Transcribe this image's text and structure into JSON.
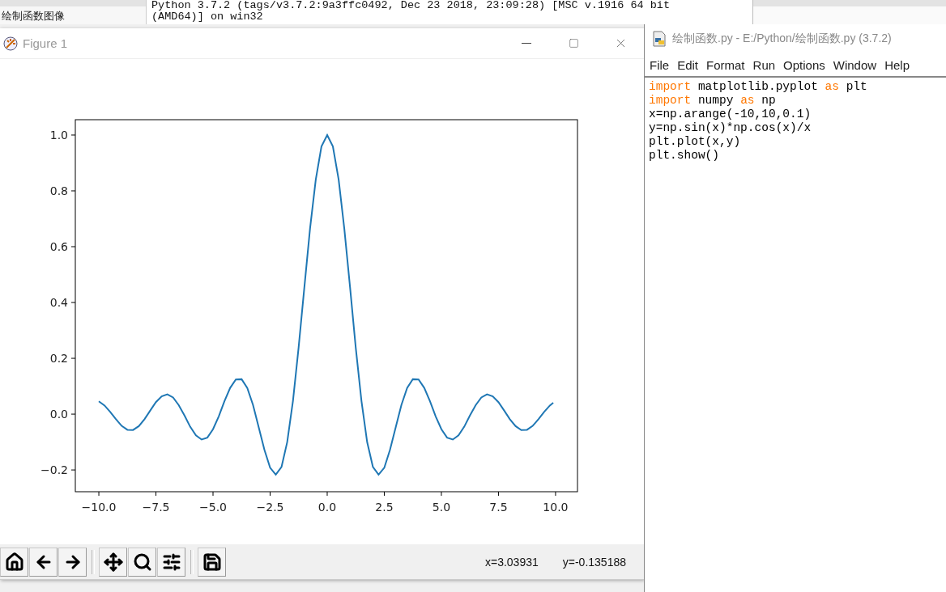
{
  "background_text": "绘制函数图像",
  "shell": {
    "lines": [
      "Python 3.7.2 (tags/v3.7.2:9a3ffc0492, Dec 23 2018, 23:09:28) [MSC v.1916 64 bit",
      "(AMD64)] on win32"
    ]
  },
  "figure_window": {
    "title": "Figure 1",
    "chart_data": {
      "type": "line",
      "xlim": [
        -11.03,
        10.96
      ],
      "ylim": [
        -0.278,
        1.055
      ],
      "xticks": [
        {
          "value": -10,
          "label": "−10.0"
        },
        {
          "value": -7.5,
          "label": "−7.5"
        },
        {
          "value": -5,
          "label": "−5.0"
        },
        {
          "value": -2.5,
          "label": "−2.5"
        },
        {
          "value": 0,
          "label": "0.0"
        },
        {
          "value": 2.5,
          "label": "2.5"
        },
        {
          "value": 5,
          "label": "5.0"
        },
        {
          "value": 7.5,
          "label": "7.5"
        },
        {
          "value": 10,
          "label": "10.0"
        }
      ],
      "yticks": [
        {
          "value": -0.2,
          "label": "−0.2"
        },
        {
          "value": 0,
          "label": "0.0"
        },
        {
          "value": 0.2,
          "label": "0.2"
        },
        {
          "value": 0.4,
          "label": "0.4"
        },
        {
          "value": 0.6,
          "label": "0.6"
        },
        {
          "value": 0.8,
          "label": "0.8"
        },
        {
          "value": 1,
          "label": "1.0"
        }
      ],
      "x": [
        -10,
        -9.75,
        -9.5,
        -9.25,
        -9,
        -8.75,
        -8.5,
        -8.25,
        -8,
        -7.75,
        -7.5,
        -7.25,
        -7,
        -6.75,
        -6.5,
        -6.25,
        -6,
        -5.75,
        -5.5,
        -5.25,
        -5,
        -4.75,
        -4.5,
        -4.25,
        -4,
        -3.75,
        -3.5,
        -3.25,
        -3,
        -2.75,
        -2.5,
        -2.25,
        -2,
        -1.75,
        -1.5,
        -1.25,
        -1,
        -0.75,
        -0.5,
        -0.25,
        0,
        0.25,
        0.5,
        0.75,
        1,
        1.25,
        1.5,
        1.75,
        2,
        2.25,
        2.5,
        2.75,
        3,
        3.25,
        3.5,
        3.75,
        4,
        4.25,
        4.5,
        4.75,
        5,
        5.25,
        5.5,
        5.75,
        6,
        6.25,
        6.5,
        6.75,
        7,
        7.25,
        7.5,
        7.75,
        8,
        8.25,
        8.5,
        8.75,
        9,
        9.25,
        9.5,
        9.75,
        9.9
      ],
      "series": [
        {
          "color": "#1f77b4",
          "values": [
            0.046,
            0.031,
            0.008,
            -0.018,
            -0.042,
            -0.056,
            -0.057,
            -0.043,
            -0.018,
            0.013,
            0.043,
            0.064,
            0.071,
            0.06,
            0.032,
            -0.005,
            -0.045,
            -0.076,
            -0.091,
            -0.084,
            -0.054,
            -0.008,
            0.046,
            0.094,
            0.124,
            0.125,
            0.094,
            0.033,
            -0.047,
            -0.128,
            -0.192,
            -0.217,
            -0.189,
            -0.1,
            0.047,
            0.239,
            0.455,
            0.665,
            0.841,
            0.959,
            1,
            0.959,
            0.841,
            0.665,
            0.455,
            0.239,
            0.047,
            -0.1,
            -0.189,
            -0.217,
            -0.192,
            -0.128,
            -0.047,
            0.033,
            0.094,
            0.125,
            0.124,
            0.094,
            0.046,
            -0.008,
            -0.054,
            -0.084,
            -0.091,
            -0.076,
            -0.045,
            -0.005,
            0.032,
            0.06,
            0.071,
            0.064,
            0.043,
            0.013,
            -0.018,
            -0.043,
            -0.057,
            -0.056,
            -0.042,
            -0.018,
            0.008,
            0.031,
            0.041
          ]
        }
      ]
    },
    "coordinates": [
      "x=3.03931",
      "y=-0.135188"
    ]
  },
  "editor": {
    "title": "绘制函数.py - E:/Python/绘制函数.py (3.7.2)",
    "menu": [
      "File",
      "Edit",
      "Format",
      "Run",
      "Options",
      "Window",
      "Help"
    ],
    "code": [
      [
        {
          "text": "import",
          "kind": "keyword"
        },
        {
          "text": " matplotlib.pyplot ",
          "kind": "plain"
        },
        {
          "text": "as",
          "kind": "keyword"
        },
        {
          "text": " plt",
          "kind": "plain"
        }
      ],
      [
        {
          "text": "import",
          "kind": "keyword"
        },
        {
          "text": " numpy ",
          "kind": "plain"
        },
        {
          "text": "as",
          "kind": "keyword"
        },
        {
          "text": " np",
          "kind": "plain"
        }
      ],
      [
        {
          "text": "x=np.arange(-10,10,0.1)",
          "kind": "plain"
        }
      ],
      [
        {
          "text": "y=np.sin(x)*np.cos(x)/x",
          "kind": "plain"
        }
      ],
      [
        {
          "text": "plt.plot(x,y)",
          "kind": "plain"
        }
      ],
      [
        {
          "text": "plt.show()",
          "kind": "plain"
        }
      ]
    ]
  }
}
